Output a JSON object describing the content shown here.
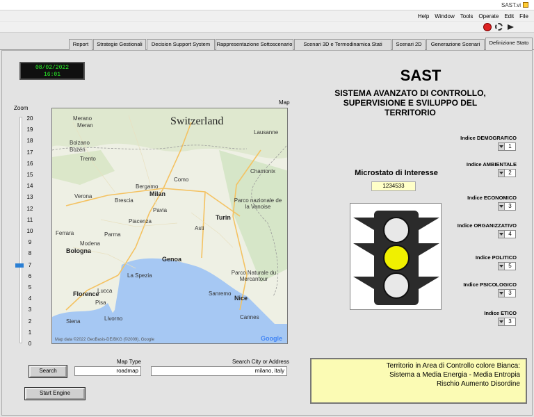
{
  "window": {
    "title": "SAST.vi"
  },
  "menu": [
    "File",
    "Edit",
    "Operate",
    "Tools",
    "Window",
    "Help"
  ],
  "tabs": [
    {
      "label": "Definizione Stato",
      "active": true
    },
    {
      "label": "Generazione Scenari",
      "active": false
    },
    {
      "label": "Scenari 2D",
      "active": false
    },
    {
      "label": "Scenari 3D e Termodinamica Stati",
      "active": false
    },
    {
      "label": "Rappresentazione Sottoscenario",
      "active": false
    },
    {
      "label": "Decision Support System",
      "active": false
    },
    {
      "label": "Strategie Gestionali",
      "active": false
    },
    {
      "label": "Report",
      "active": false
    }
  ],
  "clock": {
    "date": "08/02/2022",
    "time": "16:01"
  },
  "zoom": {
    "label": "Zoom",
    "ticks": [
      "20",
      "19",
      "18",
      "17",
      "16",
      "15",
      "14",
      "13",
      "12",
      "11",
      "10",
      "9",
      "8",
      "7",
      "6",
      "5",
      "4",
      "3",
      "2",
      "1",
      "0"
    ],
    "value": 7
  },
  "map": {
    "label": "Map",
    "country": "Switzerland",
    "cities_big": [
      {
        "name": "Milan"
      },
      {
        "name": "Turin"
      },
      {
        "name": "Genoa"
      },
      {
        "name": "Bologna"
      },
      {
        "name": "Florence"
      },
      {
        "name": "Nice"
      }
    ],
    "cities": [
      "Lausanne",
      "Merano",
      "Meran",
      "Bolzano",
      "Bozen",
      "Trento",
      "Como",
      "Bergamo",
      "Brescia",
      "Verona",
      "Pavia",
      "Piacenza",
      "Parma",
      "Modena",
      "Ferrara",
      "Asti",
      "Parco nazionale de la Vanoise",
      "Parco Naturale du Mercantour",
      "La Spezia",
      "Lucca",
      "Pisa",
      "Livorno",
      "Siena",
      "Sanremo",
      "Cannes",
      "Chamonix"
    ],
    "footer": "Map data ©2022 GeoBasis-DE/BKG (©2009), Google",
    "logo": "Google"
  },
  "header": {
    "title": "SAST",
    "subtitle": "SISTEMA AVANZATO DI CONTROLLO, SUPERVISIONE E SVILUPPO DEL TERRITORIO"
  },
  "indices": [
    {
      "label": "Indice DEMOGRAFICO",
      "value": "1"
    },
    {
      "label": "Indice AMBIENTALE",
      "value": "2"
    },
    {
      "label": "Indice ECONOMICO",
      "value": "3"
    },
    {
      "label": "Indice ORGANIZZATIVO",
      "value": "4"
    },
    {
      "label": "Indice POLITICO",
      "value": "5"
    },
    {
      "label": "Indice PSICOLOGICO",
      "value": "3"
    },
    {
      "label": "Indice ETICO",
      "value": "3"
    }
  ],
  "microstato": {
    "label": "Microstato di Interesse",
    "value": "1234533"
  },
  "traffic_light": {
    "active": "middle",
    "colors": {
      "lamp_off": "#e8e8e8",
      "lamp_on": "#f0f000",
      "body": "#2b2b2b"
    }
  },
  "search": {
    "address_label": "Search City or Address",
    "address_value": "milano, italy",
    "maptype_label": "Map Type",
    "maptype_value": "roadmap",
    "search_button": "Search",
    "start_button": "Start Engine"
  },
  "status": {
    "lines": [
      "Territorio in Area di Controllo colore  Bianca:",
      "Sistema a Media Energia - Media Entropia",
      "Rischio Aumento Disordine"
    ],
    "color": "#fbfbb4"
  }
}
